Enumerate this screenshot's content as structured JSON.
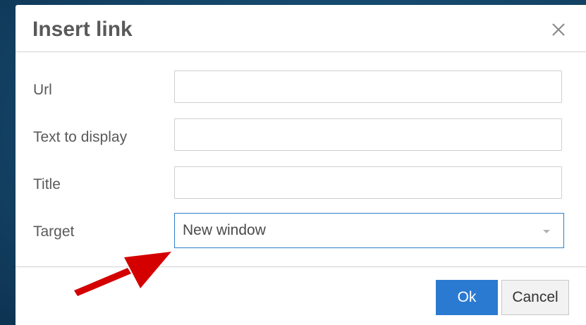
{
  "dialog": {
    "title": "Insert link",
    "close_icon": "close-icon"
  },
  "form": {
    "url": {
      "label": "Url",
      "value": ""
    },
    "text_to_display": {
      "label": "Text to display",
      "value": ""
    },
    "title": {
      "label": "Title",
      "value": ""
    },
    "target": {
      "label": "Target",
      "selected": "New window",
      "icon": "chevron-down-icon"
    }
  },
  "footer": {
    "ok_label": "Ok",
    "cancel_label": "Cancel"
  },
  "annotation": {
    "icon": "red-pointer-arrow-icon",
    "color": "#d40000"
  },
  "colors": {
    "accent": "#2b7ad1",
    "select_border": "#2d80c8",
    "background": "#164a6e"
  }
}
